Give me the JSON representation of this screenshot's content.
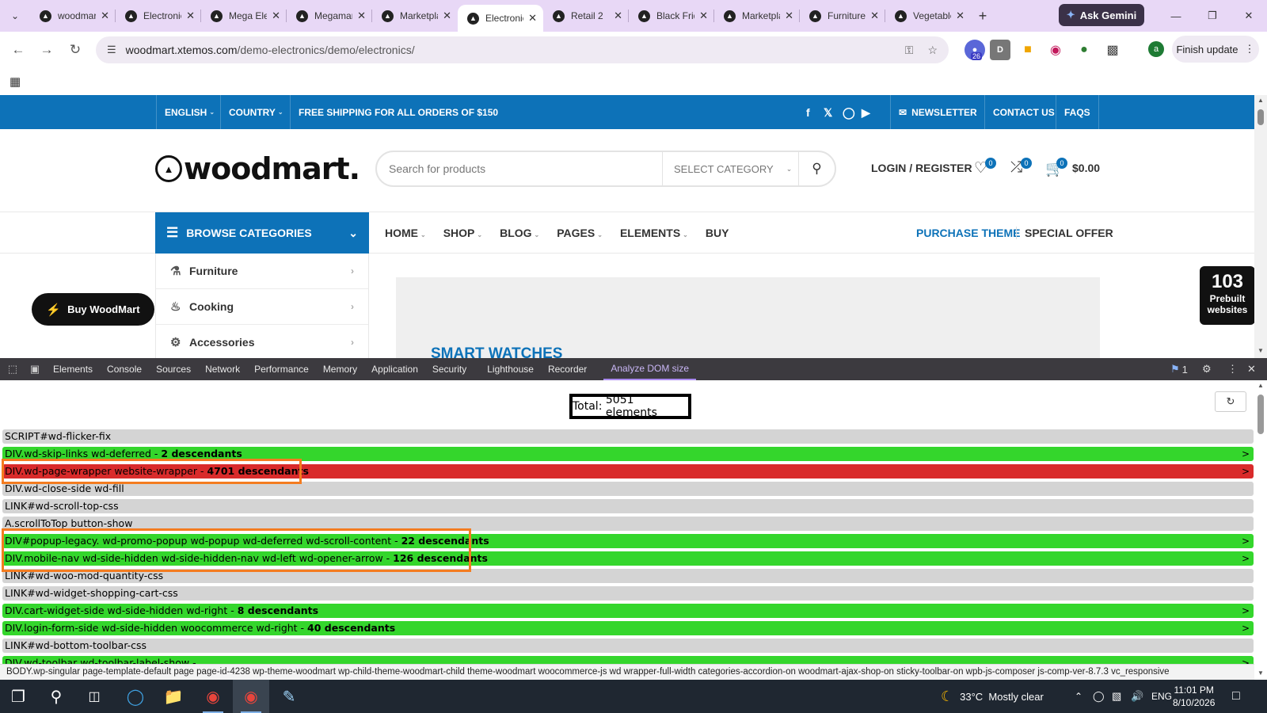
{
  "browser": {
    "tabs": [
      {
        "label": "woodmart",
        "active": false
      },
      {
        "label": "Electronics",
        "active": false
      },
      {
        "label": "Mega Electronics",
        "active": false
      },
      {
        "label": "Megamarket",
        "active": false
      },
      {
        "label": "Marketplace",
        "active": false
      },
      {
        "label": "Electronics",
        "active": true
      },
      {
        "label": "Retail 2",
        "active": false
      },
      {
        "label": "Black Friday",
        "active": false
      },
      {
        "label": "Marketplace",
        "active": false
      },
      {
        "label": "Furniture",
        "active": false
      },
      {
        "label": "Vegetables",
        "active": false
      }
    ],
    "gemini_label": "Ask Gemini",
    "url_host": "woodmart.xtemos.com",
    "url_path": "/demo-electronics/demo/electronics/",
    "extension_badge": "26",
    "profile_initial": "a",
    "finish_update_label": "Finish update"
  },
  "site": {
    "topbar": {
      "language": "ENGLISH",
      "country": "COUNTRY",
      "shipping": "FREE SHIPPING FOR ALL ORDERS OF $150",
      "newsletter": "NEWSLETTER",
      "contact": "CONTACT US",
      "faqs": "FAQS"
    },
    "logo_text": "woodmart.",
    "search_placeholder": "Search for products",
    "select_category": "SELECT CATEGORY",
    "login": "LOGIN / REGISTER",
    "wishlist_count": "0",
    "compare_count": "0",
    "cart_count": "0",
    "cart_total": "$0.00",
    "browse_categories": "BROWSE CATEGORIES",
    "nav": [
      "HOME",
      "SHOP",
      "BLOG",
      "PAGES",
      "ELEMENTS",
      "BUY"
    ],
    "purchase_theme": "PURCHASE THEME",
    "special_offer": "SPECIAL OFFER",
    "categories": [
      "Furniture",
      "Cooking",
      "Accessories"
    ],
    "buy_woodmart": "Buy WoodMart",
    "banner_title": "SMART WATCHES",
    "prebuilt_count": "103",
    "prebuilt_label_1": "Prebuilt",
    "prebuilt_label_2": "websites"
  },
  "devtools": {
    "tabs": [
      "Elements",
      "Console",
      "Sources",
      "Network",
      "Performance",
      "Memory",
      "Application",
      "Security",
      "Lighthouse",
      "Recorder",
      "Analyze DOM size"
    ],
    "active_tab": "Analyze DOM size",
    "issues_count": "1",
    "total_label": "Total:",
    "total_value": "5051 elements",
    "rows": [
      {
        "text": "SCRIPT#wd-flicker-fix",
        "desc": "",
        "color": "gray"
      },
      {
        "text": "DIV.wd-skip-links wd-deferred - ",
        "desc": "2 descendants",
        "color": "green"
      },
      {
        "text": "DIV.wd-page-wrapper website-wrapper - ",
        "desc": "4701 descendants",
        "color": "red"
      },
      {
        "text": "DIV.wd-close-side wd-fill",
        "desc": "",
        "color": "gray"
      },
      {
        "text": "LINK#wd-scroll-top-css",
        "desc": "",
        "color": "gray"
      },
      {
        "text": "A.scrollToTop button-show",
        "desc": "",
        "color": "gray"
      },
      {
        "text": "DIV#popup-legacy. wd-promo-popup wd-popup wd-deferred wd-scroll-content - ",
        "desc": "22 descendants",
        "color": "green"
      },
      {
        "text": "DIV.mobile-nav wd-side-hidden wd-side-hidden-nav wd-left wd-opener-arrow - ",
        "desc": "126 descendants",
        "color": "green"
      },
      {
        "text": "LINK#wd-woo-mod-quantity-css",
        "desc": "",
        "color": "gray"
      },
      {
        "text": "LINK#wd-widget-shopping-cart-css",
        "desc": "",
        "color": "gray"
      },
      {
        "text": "DIV.cart-widget-side wd-side-hidden wd-right - ",
        "desc": "8 descendants",
        "color": "green"
      },
      {
        "text": "DIV.login-form-side wd-side-hidden woocommerce wd-right - ",
        "desc": "40 descendants",
        "color": "green"
      },
      {
        "text": "LINK#wd-bottom-toolbar-css",
        "desc": "",
        "color": "gray"
      },
      {
        "text": "DIV.wd-toolbar wd-toolbar-label-show - ",
        "desc": "",
        "color": "green"
      }
    ],
    "breadcrumb": "BODY.wp-singular page-template-default page page-id-4238 wp-theme-woodmart wp-child-theme-woodmart-child theme-woodmart woocommerce-js wd wrapper-full-width categories-accordion-on woodmart-ajax-shop-on sticky-toolbar-on wpb-js-composer js-comp-ver-8.7.3 vc_responsive"
  },
  "taskbar": {
    "temperature": "33°C",
    "weather": "Mostly clear",
    "language": "ENG",
    "time": "11:01 PM",
    "date": "8/10/2026"
  }
}
